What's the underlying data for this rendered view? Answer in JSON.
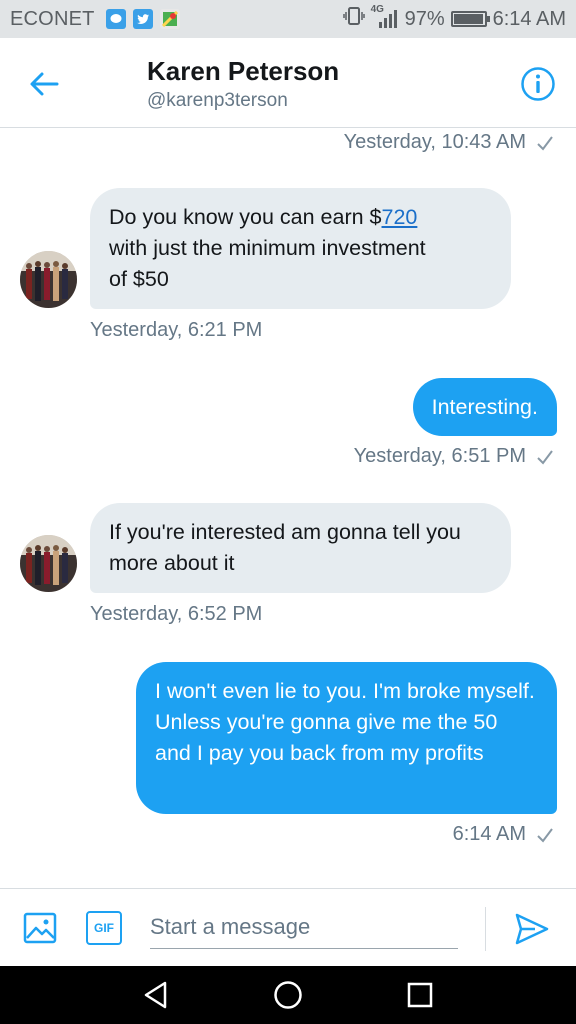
{
  "status_bar": {
    "carrier": "ECONET",
    "network": "4G",
    "battery": "97%",
    "battery_level": 0.97,
    "time": "6:14 AM"
  },
  "header": {
    "title": "Karen Peterson",
    "handle": "@karenp3terson"
  },
  "messages": [
    {
      "id": "m0",
      "direction": "out",
      "timestamp": "Yesterday, 10:43 AM",
      "read": true
    },
    {
      "id": "m1",
      "direction": "in",
      "text_before": "Do you know you can earn $",
      "link": "720",
      "text_after": "\nwith just the minimum investment\nof $50",
      "timestamp": "Yesterday, 6:21 PM"
    },
    {
      "id": "m2",
      "direction": "out",
      "text": "Interesting.",
      "timestamp": "Yesterday, 6:51 PM",
      "read": true
    },
    {
      "id": "m3",
      "direction": "in",
      "text": "If you're interested am gonna tell you more about it",
      "timestamp": "Yesterday, 6:52 PM"
    },
    {
      "id": "m4",
      "direction": "out",
      "text": "I won't even lie to you. I'm broke myself. Unless you're gonna give me the 50 and I pay you back from my profits",
      "timestamp": "6:14 AM",
      "read": true
    }
  ],
  "composer": {
    "placeholder": "Start a message",
    "gif_label": "GIF"
  },
  "colors": {
    "accent": "#1da1f2",
    "incoming_bubble": "#e6ecf0",
    "status_bar": "#e1e4e6",
    "nav_bar": "#000000"
  },
  "icons": {
    "back": "arrow-left-icon",
    "info": "info-icon",
    "media": "image-icon",
    "send": "send-icon",
    "nav": [
      "back-triangle-icon",
      "home-circle-icon",
      "recents-square-icon"
    ]
  }
}
